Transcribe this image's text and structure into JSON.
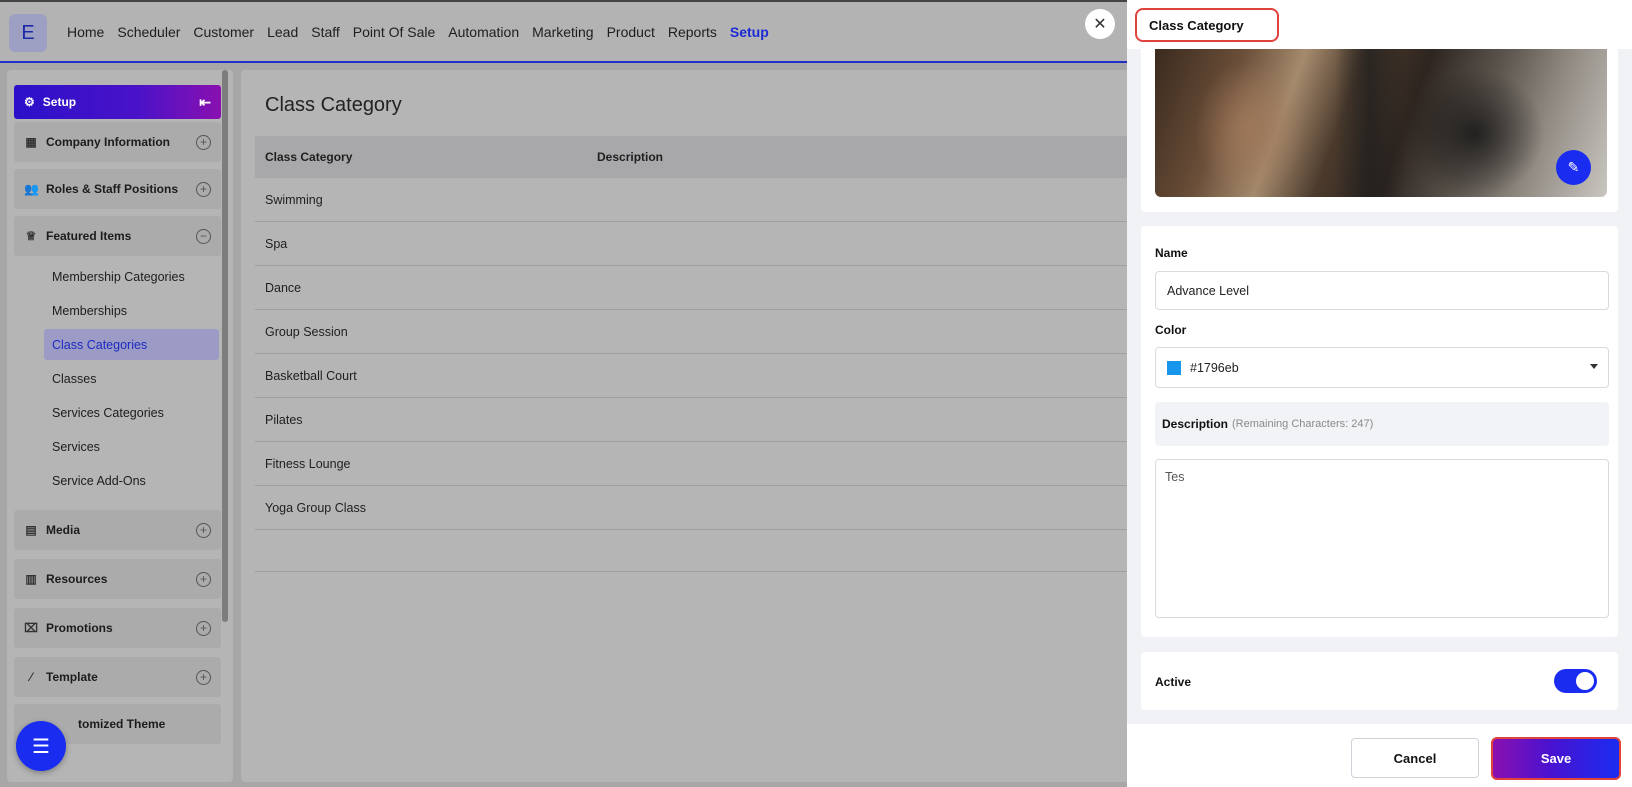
{
  "brand": {
    "logo_letter": "E"
  },
  "nav": {
    "items": [
      "Home",
      "Scheduler",
      "Customer",
      "Lead",
      "Staff",
      "Point Of Sale",
      "Automation",
      "Marketing",
      "Product",
      "Reports",
      "Setup"
    ],
    "active": "Setup"
  },
  "sidebar": {
    "header": "Setup",
    "sections": [
      {
        "label": "Company Information",
        "icon": "building-icon",
        "expanded": false
      },
      {
        "label": "Roles & Staff Positions",
        "icon": "users-icon",
        "expanded": false
      },
      {
        "label": "Featured Items",
        "icon": "crown-icon",
        "expanded": true
      },
      {
        "label": "Media",
        "icon": "media-icon",
        "expanded": false
      },
      {
        "label": "Resources",
        "icon": "resources-icon",
        "expanded": false
      },
      {
        "label": "Promotions",
        "icon": "gift-icon",
        "expanded": false
      },
      {
        "label": "Template",
        "icon": "wand-icon",
        "expanded": false
      },
      {
        "label": "Customized Theme",
        "icon": "theme-icon",
        "expanded": false
      }
    ],
    "featured_items": [
      "Membership Categories",
      "Memberships",
      "Class Categories",
      "Classes",
      "Services Categories",
      "Services",
      "Service Add-Ons"
    ],
    "active_item": "Class Categories",
    "customized_theme_visible": "tomized Theme"
  },
  "main": {
    "title": "Class Category",
    "columns": [
      "Class Category",
      "Description"
    ],
    "rows": [
      "Swimming",
      "Spa",
      "Dance",
      "Group Session",
      "Basketball Court",
      "Pilates",
      "Fitness Lounge",
      "Yoga Group Class"
    ]
  },
  "panel": {
    "title": "Class Category",
    "name_label": "Name",
    "name_value": "Advance Level",
    "color_label": "Color",
    "color_value": "#1796eb",
    "description_label": "Description",
    "description_remaining": "(Remaining Characters: 247)",
    "description_value": "Tes",
    "active_label": "Active",
    "active_on": true,
    "cancel_label": "Cancel",
    "save_label": "Save"
  },
  "colors": {
    "accent": "#1a2cf0",
    "highlight": "#e0433c",
    "swatch": "#1796eb"
  }
}
